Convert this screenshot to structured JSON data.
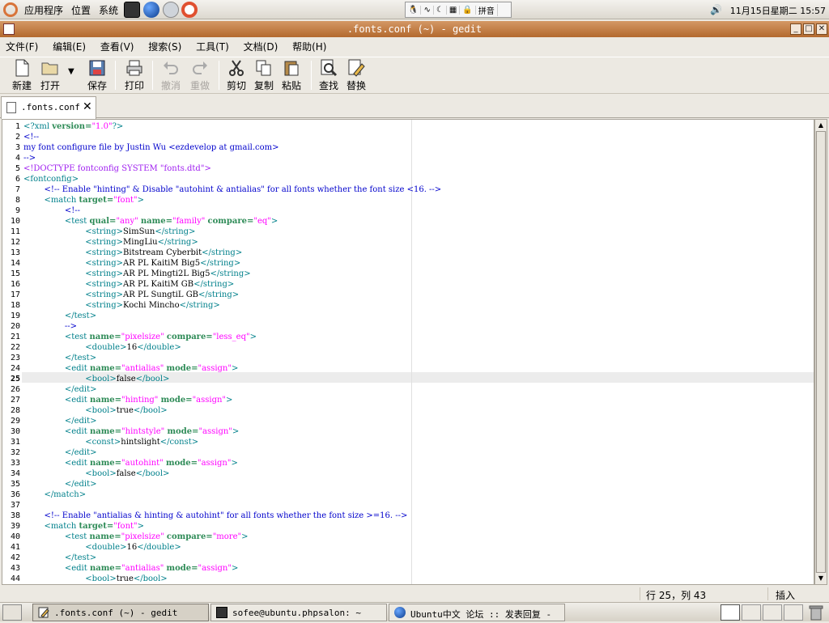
{
  "top_panel": {
    "menus": [
      "应用程序",
      "位置",
      "系统"
    ],
    "ime": [
      "拼音"
    ],
    "clock": "11月15日星期二 15:57"
  },
  "window": {
    "title": ".fonts.conf (~) - gedit"
  },
  "menubar": [
    "文件(F)",
    "编辑(E)",
    "查看(V)",
    "搜索(S)",
    "工具(T)",
    "文档(D)",
    "帮助(H)"
  ],
  "toolbar": {
    "new": "新建",
    "open": "打开",
    "save": "保存",
    "print": "打印",
    "undo": "撤消",
    "redo": "重做",
    "cut": "剪切",
    "copy": "复制",
    "paste": "粘贴",
    "find": "查找",
    "replace": "替换"
  },
  "tab": {
    "label": ".fonts.conf"
  },
  "editor": {
    "current_line": 25,
    "lines": [
      "<?xml version=\"1.0\"?>",
      "<!--",
      "my font configure file by Justin Wu <ezdevelop at gmail.com>",
      "-->",
      "<!DOCTYPE fontconfig SYSTEM \"fonts.dtd\">",
      "<fontconfig>",
      "        <!-- Enable \"hinting\" & Disable \"autohint & antialias\" for all fonts whether the font size <16. -->",
      "        <match target=\"font\">",
      "                <!--",
      "                <test qual=\"any\" name=\"family\" compare=\"eq\">",
      "                        <string>SimSun</string>",
      "                        <string>MingLiu</string>",
      "                        <string>Bitstream Cyberbit</string>",
      "                        <string>AR PL KaitiM Big5</string>",
      "                        <string>AR PL Mingti2L Big5</string>",
      "                        <string>AR PL KaitiM GB</string>",
      "                        <string>AR PL SungtiL GB</string>",
      "                        <string>Kochi Mincho</string>",
      "                </test>",
      "                -->",
      "                <test name=\"pixelsize\" compare=\"less_eq\">",
      "                        <double>16</double>",
      "                </test>",
      "                <edit name=\"antialias\" mode=\"assign\">",
      "                        <bool>false</bool>",
      "                </edit>",
      "                <edit name=\"hinting\" mode=\"assign\">",
      "                        <bool>true</bool>",
      "                </edit>",
      "                <edit name=\"hintstyle\" mode=\"assign\">",
      "                        <const>hintslight</const>",
      "                </edit>",
      "                <edit name=\"autohint\" mode=\"assign\">",
      "                        <bool>false</bool>",
      "                </edit>",
      "        </match>",
      "",
      "        <!-- Enable \"antialias & hinting & autohint\" for all fonts whether the font size >=16. -->",
      "        <match target=\"font\">",
      "                <test name=\"pixelsize\" compare=\"more\">",
      "                        <double>16</double>",
      "                </test>",
      "                <edit name=\"antialias\" mode=\"assign\">",
      "                        <bool>true</bool>"
    ]
  },
  "status": {
    "position": "行 25，列 43",
    "mode": "插入"
  },
  "taskbar": [
    ".fonts.conf (~) - gedit",
    "sofee@ubuntu.phpsalon: ~",
    "Ubuntu中文 论坛 :: 发表回复 -"
  ],
  "colors": {
    "titlebar": "#b3692e",
    "tag": "#00808b",
    "string": "#ff00ff",
    "comment": "#0000cc"
  }
}
